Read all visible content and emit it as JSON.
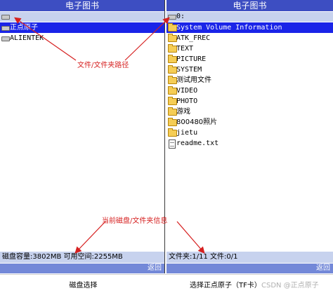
{
  "left_pane": {
    "title": "电子图书",
    "items": [
      {
        "label": "正点原子",
        "icon": "drive-icon",
        "selected": true
      },
      {
        "label": "ALIENTEK",
        "icon": "drive-icon",
        "selected": false
      }
    ],
    "status": "磁盘容量:3802MB 可用空间:2255MB",
    "back": "返回"
  },
  "right_pane": {
    "title": "电子图书",
    "path": "0:",
    "items": [
      {
        "label": "System Volume Information",
        "icon": "folder-icon",
        "selected": true
      },
      {
        "label": "ATK_FREC",
        "icon": "folder-icon"
      },
      {
        "label": "TEXT",
        "icon": "folder-icon"
      },
      {
        "label": "PICTURE",
        "icon": "folder-icon"
      },
      {
        "label": "SYSTEM",
        "icon": "folder-icon"
      },
      {
        "label": "测试用文件",
        "icon": "folder-icon"
      },
      {
        "label": "VIDEO",
        "icon": "folder-icon"
      },
      {
        "label": "PHOTO",
        "icon": "folder-icon"
      },
      {
        "label": "游戏",
        "icon": "folder-icon"
      },
      {
        "label": "800480照片",
        "icon": "folder-icon"
      },
      {
        "label": "jietu",
        "icon": "folder-icon"
      },
      {
        "label": "readme.txt",
        "icon": "file-icon"
      }
    ],
    "status": "文件夹:1/11   文件:0/1",
    "back": "返回"
  },
  "bottom_bar": {
    "left": "磁盘选择",
    "right": "选择正点原子（TF卡）"
  },
  "annotations": {
    "path_label": "文件/文件夹路径",
    "info_label": "当前磁盘/文件夹信息",
    "color": "#d62020"
  },
  "watermark": "CSDN @正点原子",
  "colors": {
    "title_bar": "#3d4ec2",
    "path_bar": "#c7d2ee",
    "selection": "#1a24e8",
    "back_bar": "#7388d8"
  }
}
